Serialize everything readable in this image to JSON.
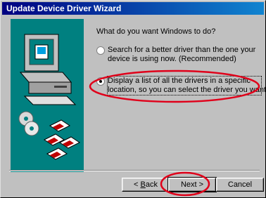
{
  "window": {
    "title": "Update Device Driver Wizard"
  },
  "wizard": {
    "prompt": "What do you want Windows to do?",
    "options": [
      {
        "lines": [
          "Search for a better driver than the one your",
          "device is using now. (Recommended)"
        ],
        "selected": false
      },
      {
        "lines": [
          "Display a list of all the drivers in a specific",
          "location, so you can select the driver you want."
        ],
        "selected": true
      }
    ]
  },
  "buttons": {
    "back_prefix": "< ",
    "back_accel": "B",
    "back_rest": "ack",
    "next": "Next >",
    "cancel": "Cancel"
  },
  "colors": {
    "titlebar_start": "#000080",
    "titlebar_end": "#1084d0",
    "art_background": "#008080",
    "annotation": "#e0001a"
  },
  "icons": [
    "computer-icon",
    "cd-disc-icon",
    "floppy-disk-icon"
  ]
}
